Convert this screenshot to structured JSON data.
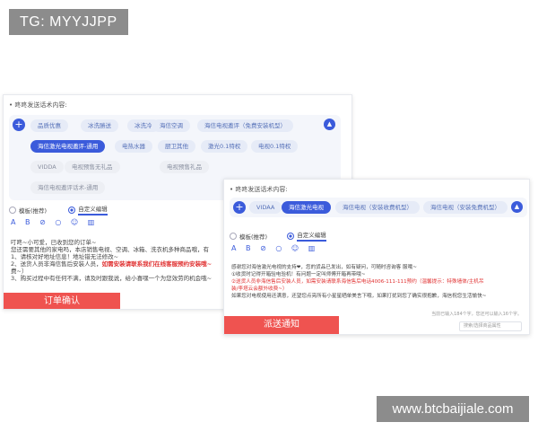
{
  "watermarks": {
    "tg": "TG: MYYJJPP",
    "site": "www.btcbaijiale.com"
  },
  "colors": {
    "accent": "#3b5bdb",
    "chip_bg": "#e6ebf7",
    "highlight_red": "#e03131",
    "button_red": "#ef5350"
  },
  "panel1": {
    "label": "• 咚咚发送话术内容:",
    "add_icon": "plus-icon",
    "collapse_icon": "chevron-up-icon",
    "chips": [
      {
        "label": "品质优惠",
        "state": "normal"
      },
      {
        "label": "冰洗勝送",
        "state": "normal"
      },
      {
        "label": "冰洗冷",
        "state": "normal"
      },
      {
        "label": "海信空调",
        "state": "normal"
      },
      {
        "label": "海信电视邀评（免费安装机型）",
        "state": "normal"
      },
      {
        "label": "海信激光电视邀评-通用",
        "state": "active"
      },
      {
        "label": "电热水器",
        "state": "normal"
      },
      {
        "label": "厨卫其他",
        "state": "normal"
      },
      {
        "label": "激光0.1特权",
        "state": "normal"
      },
      {
        "label": "电视0.1特权",
        "state": "normal"
      },
      {
        "label": "VIDDA",
        "state": "muted"
      },
      {
        "label": "电视预售无礼品",
        "state": "muted"
      },
      {
        "label": "电视预售礼品",
        "state": "muted"
      },
      {
        "label": "海信电视邀评话术-通用",
        "state": "muted"
      }
    ],
    "mode_template": "模板(推荐)",
    "mode_custom": "自定义编辑",
    "toolbar": [
      "A",
      "B",
      "⊘",
      "○",
      "☺",
      "▥"
    ],
    "text_lines": [
      "叮咚~小可爱，已收到您的订单~",
      "您还需要其他的家电吗，本店销售电视、空调、冰箱、洗衣机多种商品哦，有",
      "1、请核对好地址信息！地址错无法修改~",
      "2、送货人员非海信售后安装人员，",
      "费~）",
      "3、购买过程中有任何不满，请及时跟我说，给小喜嘿一个为您效劳的机会哦~"
    ],
    "text_red": "如需安装请联系我们在线客服预约安装哦~",
    "confirm_button": "订单确认"
  },
  "panel2": {
    "label": "• 咚咚发送话术内容:",
    "add_icon": "plus-icon",
    "collapse_icon": "chevron-up-icon",
    "chips": [
      {
        "label": "VIDAA",
        "state": "normal"
      },
      {
        "label": "海信激光电视",
        "state": "active"
      },
      {
        "label": "海信电视（安装收费机型）",
        "state": "normal"
      },
      {
        "label": "海信电视（安装免费机型）",
        "state": "normal"
      }
    ],
    "mode_template": "模板(推荐)",
    "mode_custom": "自定义编辑",
    "toolbar": [
      "A",
      "B",
      "⊘",
      "○",
      "☺",
      "▥"
    ],
    "text_lines": [
      "感谢您对海信激光电视的支持❤，您的货品已发出，如有疑问，可随时咨询客 服哦~",
      "①收货时记得开箱验电验机！有问题一定叫师傅开箱再带哦~",
      "装/李塔云会额外收费~）",
      "如果您对电视使用还满意，还望您点亮所有小星星晒单美言下哦，如果打扰到您了确实很抱歉，海信祝您生活愉快~"
    ],
    "text_red": "②送货人员非海信售后安装人员，如需安装请联系海信售后电话4006-111-111预约（温馨提示：特殊墙体/主机吊",
    "counter": "当前已输入184个字，您还可以输入16个字。",
    "select_placeholder": "搜索/选择商品属性",
    "send_button": "派送通知"
  }
}
